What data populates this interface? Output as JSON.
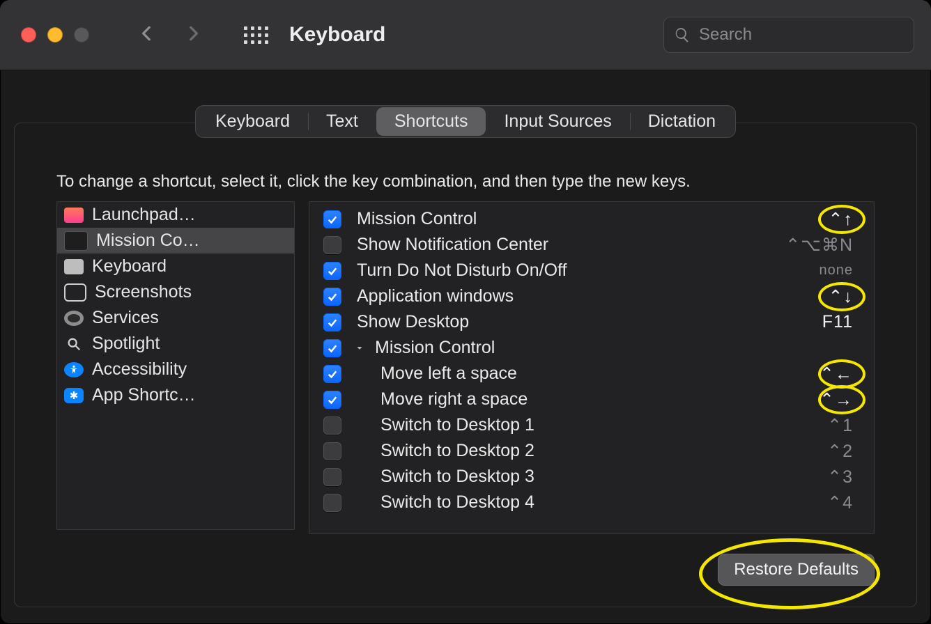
{
  "window": {
    "title": "Keyboard"
  },
  "search": {
    "placeholder": "Search"
  },
  "tabs": [
    {
      "label": "Keyboard",
      "active": false
    },
    {
      "label": "Text",
      "active": false
    },
    {
      "label": "Shortcuts",
      "active": true
    },
    {
      "label": "Input Sources",
      "active": false
    },
    {
      "label": "Dictation",
      "active": false
    }
  ],
  "instruction": "To change a shortcut, select it, click the key combination, and then type the new keys.",
  "categories": [
    {
      "label": "Launchpad…",
      "selected": false,
      "icon": "launchpad"
    },
    {
      "label": "Mission Co…",
      "selected": true,
      "icon": "mission"
    },
    {
      "label": "Keyboard",
      "selected": false,
      "icon": "keyboard"
    },
    {
      "label": "Screenshots",
      "selected": false,
      "icon": "screenshot"
    },
    {
      "label": "Services",
      "selected": false,
      "icon": "gear"
    },
    {
      "label": "Spotlight",
      "selected": false,
      "icon": "search"
    },
    {
      "label": "Accessibility",
      "selected": false,
      "icon": "access"
    },
    {
      "label": "App Shortc…",
      "selected": false,
      "icon": "appstore"
    }
  ],
  "shortcuts": [
    {
      "checked": true,
      "label": "Mission Control",
      "keys": "⌃↑",
      "indent": 0,
      "highlight": true
    },
    {
      "checked": false,
      "label": "Show Notification Center",
      "keys": "⌃⌥⌘N",
      "indent": 0,
      "dim": true
    },
    {
      "checked": true,
      "label": "Turn Do Not Disturb On/Off",
      "keys": "none",
      "indent": 0,
      "none": true
    },
    {
      "checked": true,
      "label": "Application windows",
      "keys": "⌃↓",
      "indent": 0,
      "highlight": true
    },
    {
      "checked": true,
      "label": "Show Desktop",
      "keys": "F11",
      "indent": 0
    },
    {
      "checked": true,
      "label": "Mission Control",
      "keys": "",
      "indent": 0,
      "expandable": true
    },
    {
      "checked": true,
      "label": "Move left a space",
      "keys": "⌃←",
      "indent": 1,
      "highlight": true
    },
    {
      "checked": true,
      "label": "Move right a space",
      "keys": "⌃→",
      "indent": 1,
      "highlight": true
    },
    {
      "checked": false,
      "label": "Switch to Desktop 1",
      "keys": "⌃1",
      "indent": 1,
      "dim": true
    },
    {
      "checked": false,
      "label": "Switch to Desktop 2",
      "keys": "⌃2",
      "indent": 1,
      "dim": true
    },
    {
      "checked": false,
      "label": "Switch to Desktop 3",
      "keys": "⌃3",
      "indent": 1,
      "dim": true
    },
    {
      "checked": false,
      "label": "Switch to Desktop 4",
      "keys": "⌃4",
      "indent": 1,
      "dim": true
    }
  ],
  "restore_button": "Restore Defaults"
}
